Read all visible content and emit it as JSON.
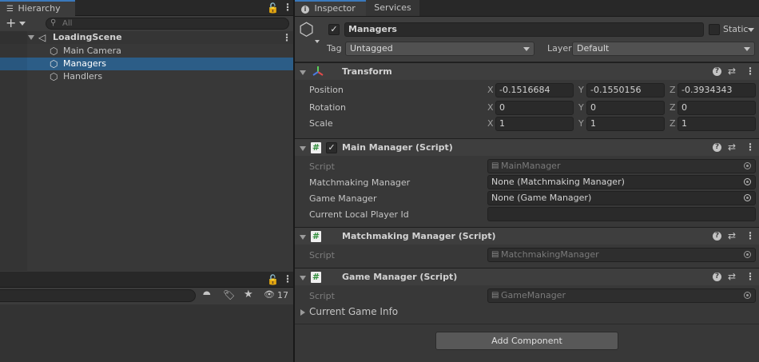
{
  "hierarchy": {
    "tab_label": "Hierarchy",
    "add_label": "+",
    "search_placeholder": "All",
    "scene_name": "LoadingScene",
    "items": [
      {
        "label": "Main Camera"
      },
      {
        "label": "Managers"
      },
      {
        "label": "Handlers"
      }
    ]
  },
  "project": {
    "hidden_count": "17"
  },
  "inspector": {
    "tab_label": "Inspector",
    "services_tab_label": "Services",
    "object": {
      "name": "Managers",
      "static_label": "Static",
      "tag_label": "Tag",
      "tag_value": "Untagged",
      "layer_label": "Layer",
      "layer_value": "Default"
    },
    "transform": {
      "title": "Transform",
      "position_label": "Position",
      "rotation_label": "Rotation",
      "scale_label": "Scale",
      "axis_x": "X",
      "axis_y": "Y",
      "axis_z": "Z",
      "position": {
        "x": "-0.1516684",
        "y": "-0.1550156",
        "z": "-0.3934343"
      },
      "rotation": {
        "x": "0",
        "y": "0",
        "z": "0"
      },
      "scale": {
        "x": "1",
        "y": "1",
        "z": "1"
      }
    },
    "main_manager": {
      "title": "Main Manager (Script)",
      "script_label": "Script",
      "script_value": "MainManager",
      "matchmaking_label": "Matchmaking Manager",
      "matchmaking_value": "None (Matchmaking Manager)",
      "game_manager_label": "Game Manager",
      "game_manager_value": "None (Game Manager)",
      "player_id_label": "Current Local Player Id",
      "player_id_value": ""
    },
    "matchmaking_manager": {
      "title": "Matchmaking Manager (Script)",
      "script_label": "Script",
      "script_value": "MatchmakingManager"
    },
    "game_manager": {
      "title": "Game Manager (Script)",
      "script_label": "Script",
      "script_value": "GameManager",
      "game_info_label": "Current Game Info"
    },
    "add_component_label": "Add Component"
  },
  "colors": {
    "accent": "#3a79bb",
    "selection": "#2c5d87",
    "panel": "#383838",
    "header": "#3e3e3e"
  }
}
